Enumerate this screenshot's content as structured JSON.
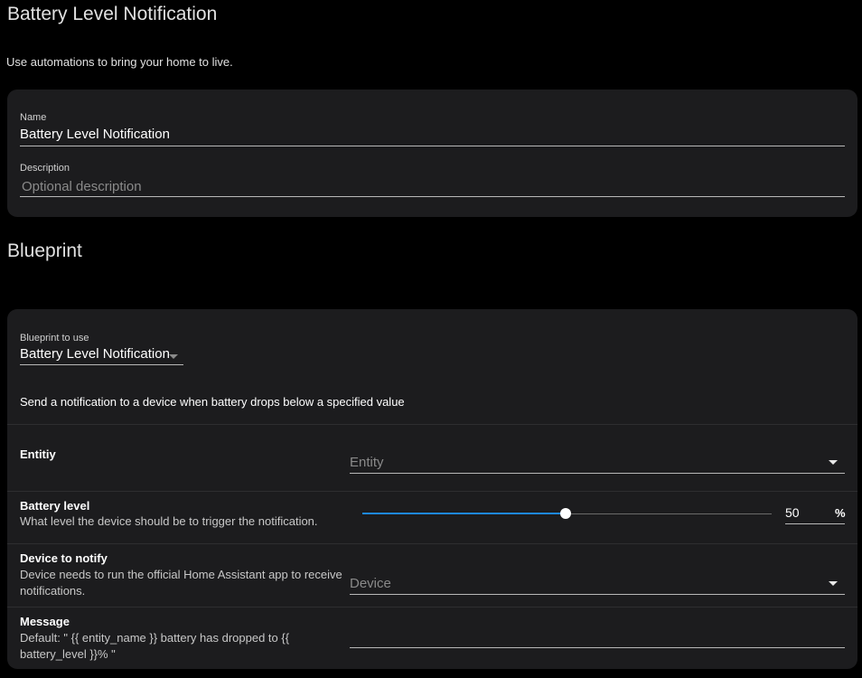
{
  "header": {
    "title": "Battery Level Notification",
    "intro": "Use automations to bring your home to live."
  },
  "info_card": {
    "name_label": "Name",
    "name_value": "Battery Level Notification",
    "description_label": "Description",
    "description_placeholder": "Optional description"
  },
  "blueprint_section": {
    "title": "Blueprint",
    "select_label": "Blueprint to use",
    "select_value": "Battery Level Notification",
    "description": "Send a notification to a device when battery drops below a specified value",
    "inputs": [
      {
        "name": "Entitiy",
        "description": "",
        "control": "select",
        "placeholder": "Entity"
      },
      {
        "name": "Battery level",
        "description": "What level the device should be to trigger the notification.",
        "control": "slider",
        "value": "50",
        "min": 0,
        "max": 100,
        "unit": "%"
      },
      {
        "name": "Device to notify",
        "description": "Device needs to run the official Home Assistant app to receive notifications.",
        "control": "select",
        "placeholder": "Device"
      },
      {
        "name": "Message",
        "description": "Default: \" {{ entity_name }} battery has dropped to {{ battery_level }}% \"",
        "control": "text",
        "value": ""
      }
    ]
  },
  "colors": {
    "background": "#000000",
    "card": "#1c1c1e",
    "accent": "#1e88e5",
    "text": "#e1e1e1"
  },
  "icons": {
    "select_arrow": "caret-down-icon",
    "slider_thumb": "slider-thumb"
  }
}
